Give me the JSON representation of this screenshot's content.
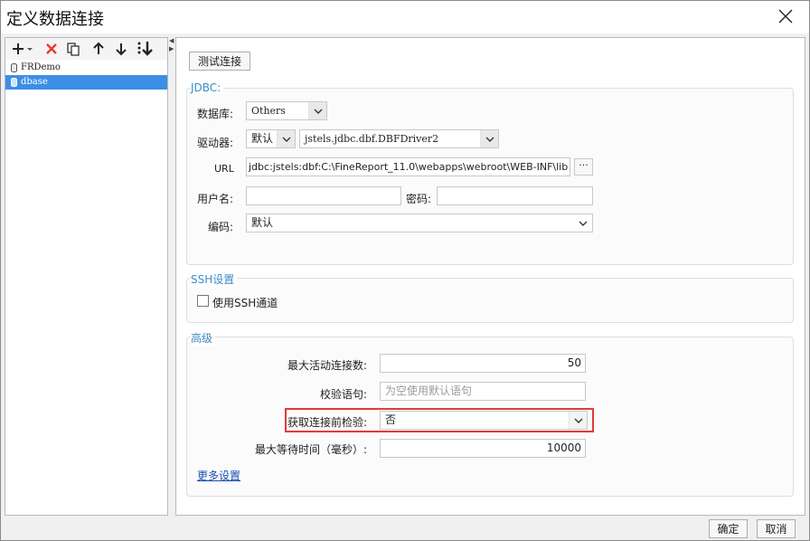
{
  "window": {
    "title": "定义数据连接"
  },
  "toolbar": {
    "add_icon": "plus-icon",
    "delete_icon": "red-x-icon",
    "copy_icon": "copy-icon",
    "up_icon": "arrow-up-icon",
    "down_icon": "arrow-down-icon",
    "sort_icon": "sort-icon"
  },
  "connections": [
    {
      "label": "FRDemo",
      "selected": false
    },
    {
      "label": "dbase",
      "selected": true
    }
  ],
  "right": {
    "test_button": "测试连接",
    "jdbc": {
      "title": "JDBC:",
      "db_label": "数据库:",
      "db_value": "Others",
      "driver_label": "驱动器:",
      "driver_mode": "默认",
      "driver_value": "jstels.jdbc.dbf.DBFDriver2",
      "url_label": "URL",
      "url_value": "jdbc:jstels:dbf:C:\\FineReport_11.0\\webapps\\webroot\\WEB-INF\\lib",
      "url_button": "···",
      "user_label": "用户名:",
      "user_value": "",
      "password_label": "密码:",
      "password_value": "",
      "encoding_label": "编码:",
      "encoding_value": "默认"
    },
    "ssh": {
      "title": "SSH设置",
      "use_ssh_label": "使用SSH通道",
      "use_ssh_checked": false
    },
    "advanced": {
      "title": "高级",
      "max_active_label": "最大活动连接数:",
      "max_active_value": "50",
      "validation_label": "校验语句:",
      "validation_placeholder": "为空使用默认语句",
      "test_before_label": "获取连接前检验:",
      "test_before_value": "否",
      "max_wait_label": "最大等待时间（毫秒）:",
      "max_wait_value": "10000",
      "more_link": "更多设置"
    }
  },
  "footer": {
    "ok": "确定",
    "cancel": "取消"
  },
  "colors": {
    "accent": "#3c8cc7",
    "selection": "#3d8ee6",
    "highlight_border": "#e23a3a",
    "delete_red": "#e53935"
  }
}
